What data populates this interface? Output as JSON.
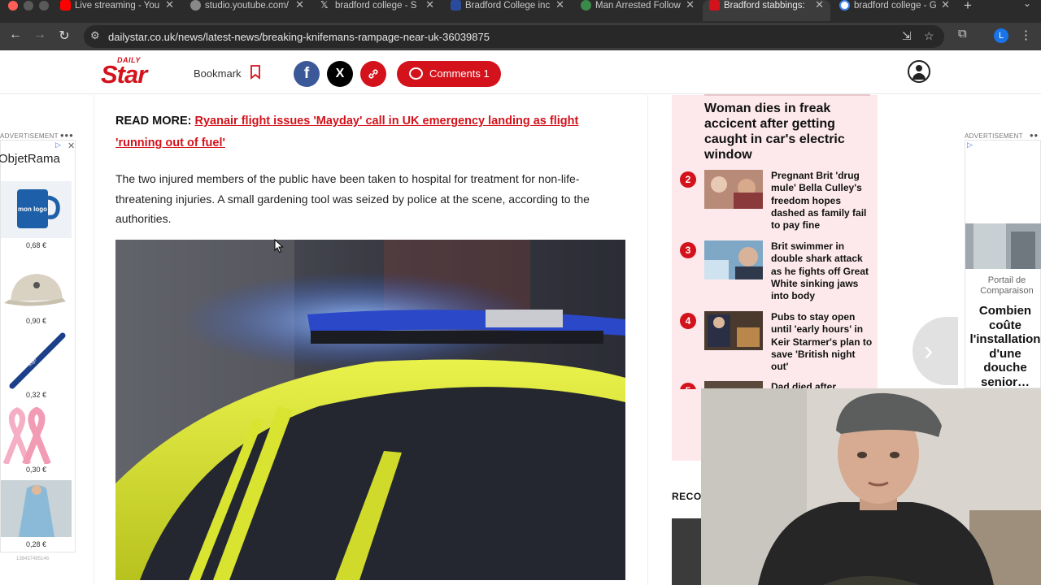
{
  "browser": {
    "tabs": [
      {
        "title": "Live streaming - You",
        "favicon_color": "#ff0000",
        "active": false
      },
      {
        "title": "studio.youtube.com/",
        "favicon_color": "#888888",
        "active": false
      },
      {
        "title": "bradford college - S",
        "favicon_color": "#000000",
        "active": false
      },
      {
        "title": "Bradford College inc",
        "favicon_color": "#2a4a9c",
        "active": false
      },
      {
        "title": "Man Arrested Follow",
        "favicon_color": "#3a8a4a",
        "active": false
      },
      {
        "title": "Bradford stabbings:",
        "favicon_color": "#d3121b",
        "active": true
      },
      {
        "title": "bradford college - G",
        "favicon_color": "#ffffff",
        "active": false
      }
    ],
    "url": "dailystar.co.uk/news/latest-news/breaking-knifemans-rampage-near-uk-36039875",
    "profile_initial": "L"
  },
  "header": {
    "logo_top": "DAILY",
    "logo_main": "Star",
    "bookmark_label": "Bookmark",
    "facebook_glyph": "f",
    "x_glyph": "X",
    "comments_label": "Comments 1"
  },
  "article": {
    "read_more_prefix": "READ MORE:",
    "read_more_link": "Ryanair flight issues 'Mayday' call in UK emergency landing as flight 'running out of fuel'",
    "paragraph": "The two injured members of the public have been taken to hospital for treatment for non-life-threatening injuries. A small gardening tool was seized by police at the scene, according to the authorities."
  },
  "trending": {
    "first_title": "Woman dies in freak accicent after getting caught in car's electric window",
    "items": [
      {
        "num": "2",
        "title": "Pregnant Brit 'drug mule' Bella Culley's freedom hopes dashed as family fail to pay fine"
      },
      {
        "num": "3",
        "title": "Brit swimmer in double shark attack as he fights off Great White sinking jaws into body"
      },
      {
        "num": "4",
        "title": "Pubs to stay open until 'early hours' in Keir Starmer's plan to save 'British night out'"
      },
      {
        "num": "5",
        "title": "Dad died after"
      }
    ],
    "recommended_label": "RECOM"
  },
  "ads": {
    "label": "ADVERTISEMENT",
    "left_brand": "ObjetRama",
    "mug_text": "mon logo",
    "pen_text": "logo",
    "left_prices": [
      "0,68 €",
      "0,90 €",
      "0,32 €",
      "0,30 €",
      "0,28 €"
    ],
    "left_code": "138437485146",
    "right_source": "Portail de Comparaison",
    "right_headline": "Combien coûte l'installation d'une douche senior…"
  },
  "colors": {
    "brand_red": "#d3121b",
    "facebook": "#3b5998",
    "trend_bg": "#fde9ec"
  }
}
